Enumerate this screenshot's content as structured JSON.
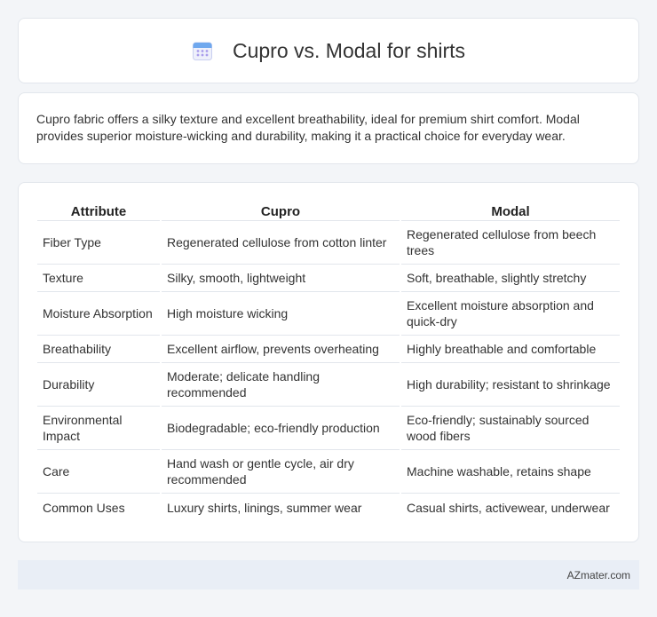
{
  "header": {
    "title": "Cupro vs. Modal for shirts",
    "icon": "calendar-icon"
  },
  "summary": "Cupro fabric offers a silky texture and excellent breathability, ideal for premium shirt comfort. Modal provides superior moisture-wicking and durability, making it a practical choice for everyday wear.",
  "table": {
    "headers": [
      "Attribute",
      "Cupro",
      "Modal"
    ],
    "rows": [
      [
        "Fiber Type",
        "Regenerated cellulose from cotton linter",
        "Regenerated cellulose from beech trees"
      ],
      [
        "Texture",
        "Silky, smooth, lightweight",
        "Soft, breathable, slightly stretchy"
      ],
      [
        "Moisture Absorption",
        "High moisture wicking",
        "Excellent moisture absorption and quick-dry"
      ],
      [
        "Breathability",
        "Excellent airflow, prevents overheating",
        "Highly breathable and comfortable"
      ],
      [
        "Durability",
        "Moderate; delicate handling recommended",
        "High durability; resistant to shrinkage"
      ],
      [
        "Environmental Impact",
        "Biodegradable; eco-friendly production",
        "Eco-friendly; sustainably sourced wood fibers"
      ],
      [
        "Care",
        "Hand wash or gentle cycle, air dry recommended",
        "Machine washable, retains shape"
      ],
      [
        "Common Uses",
        "Luxury shirts, linings, summer wear",
        "Casual shirts, activewear, underwear"
      ]
    ]
  },
  "footer": {
    "brand": "AZmater.com"
  },
  "colors": {
    "background": "#f3f5f8",
    "card": "#ffffff",
    "footer_bg": "#e9eef6",
    "icon_accent": "#9a8ee8"
  }
}
